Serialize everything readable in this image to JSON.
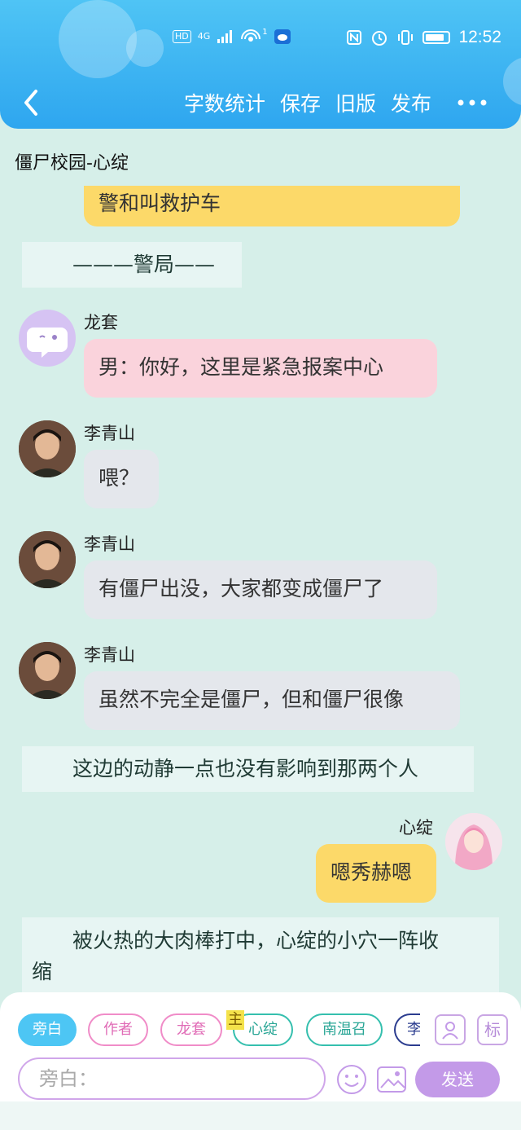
{
  "status_bar": {
    "network_label": "HD",
    "signal_label": "4G",
    "hotspot_count": "1",
    "time": "12:52"
  },
  "nav": {
    "back_icon": "chevron-left-icon",
    "actions": [
      "字数统计",
      "保存",
      "旧版",
      "发布"
    ],
    "more_icon": "more-dots-icon"
  },
  "story_title": "僵尸校园-心绽",
  "messages": {
    "m0": {
      "text": "警和叫救护车"
    },
    "m1": {
      "text": "———警局——"
    },
    "m2": {
      "name": "龙套",
      "text": "男：你好，这里是紧急报案中心"
    },
    "m3": {
      "name": "李青山",
      "text": "喂？"
    },
    "m4": {
      "name": "李青山",
      "text": "有僵尸出没，大家都变成僵尸了"
    },
    "m5": {
      "name": "李青山",
      "text": "虽然不完全是僵尸，但和僵尸很像"
    },
    "m6": {
      "text": "这边的动静一点也没有影响到那两个人"
    },
    "m7": {
      "name": "心绽",
      "text": "嗯秀赫嗯"
    },
    "m8": {
      "line1": "被火热的大肉棒打中，心绽的小穴一阵收",
      "line2": "缩"
    }
  },
  "roles": [
    "旁白",
    "作者",
    "龙套",
    "心绽",
    "南温召",
    "李"
  ],
  "role_tag": "主",
  "input": {
    "placeholder": "旁白："
  },
  "send_label": "发送",
  "tool_labels": {
    "role": "👤",
    "tag": "标"
  },
  "colors": {
    "header": "#2ea6ef",
    "yellow_bubble": "#fcd969",
    "pink_bubble": "#fad3dc",
    "grey_bubble": "#e4e7ec",
    "send": "#c39ae8"
  }
}
